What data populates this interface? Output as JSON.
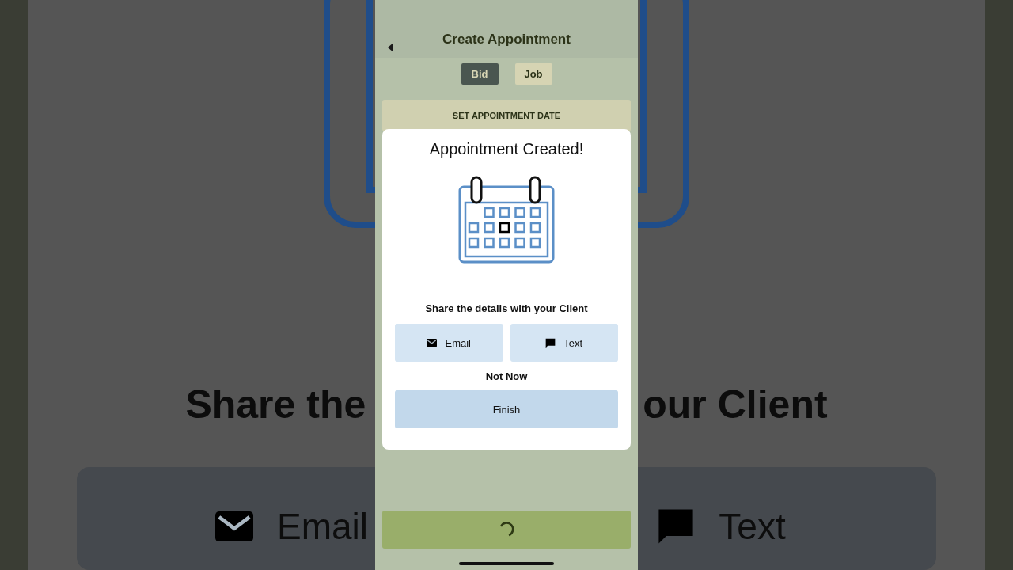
{
  "background": {
    "heading_left": "Share the",
    "heading_right": "our Client",
    "buttons": [
      {
        "label": "Email",
        "kind": "email"
      },
      {
        "label": "Text",
        "kind": "message"
      }
    ]
  },
  "header": {
    "title": "Create Appointment"
  },
  "tabs": [
    {
      "label": "Bid",
      "selected": true
    },
    {
      "label": "Job",
      "selected": false
    }
  ],
  "section": {
    "title": "SET APPOINTMENT DATE"
  },
  "dialog": {
    "title": "Appointment Created!",
    "prompt": "Share the details with your Client",
    "share_buttons": [
      {
        "label": "Email",
        "kind": "email"
      },
      {
        "label": "Text",
        "kind": "message"
      }
    ],
    "dismiss": "Not Now",
    "primary": "Finish"
  },
  "bottom_button": {
    "loading": true
  }
}
